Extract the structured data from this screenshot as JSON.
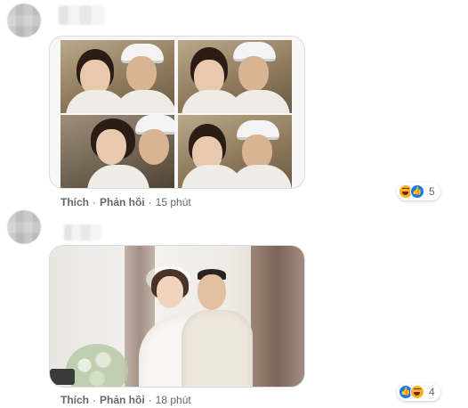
{
  "comments": [
    {
      "actions": {
        "like": "Thích",
        "reply": "Phản hồi",
        "time": "15 phút"
      },
      "reactions": {
        "icons": [
          "haha-icon",
          "like-icon"
        ],
        "count": "5"
      }
    },
    {
      "actions": {
        "like": "Thích",
        "reply": "Phản hồi",
        "time": "18 phút"
      },
      "reactions": {
        "icons": [
          "like-icon",
          "haha-icon"
        ],
        "count": "4"
      }
    }
  ],
  "separator": "·",
  "colors": {
    "meta_text": "#65676b",
    "like_blue": "#1877f2",
    "haha_yellow": "#f7b125"
  }
}
